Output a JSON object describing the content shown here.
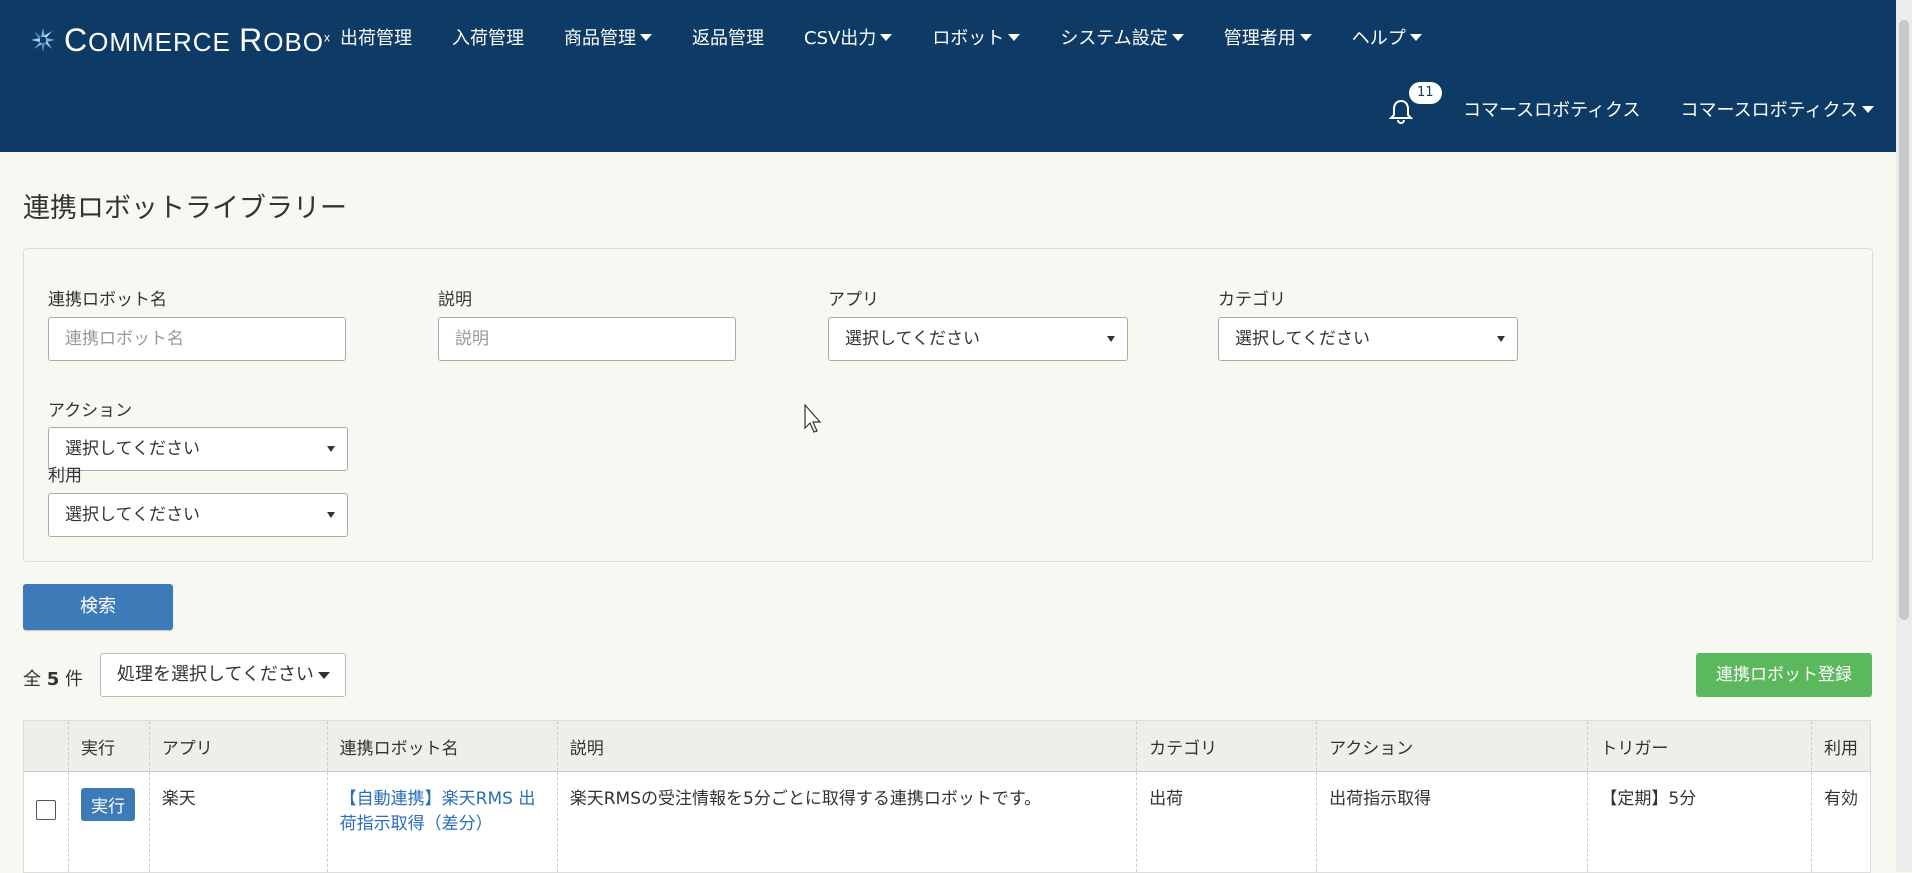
{
  "brand": {
    "logo_text_c": "C",
    "logo_text_rest": "OMMERCE ",
    "logo_text_r": "R",
    "logo_text_rest2": "OBO",
    "logo_sup": "x"
  },
  "nav": {
    "items": [
      {
        "label": "出荷管理",
        "dropdown": false
      },
      {
        "label": "入荷管理",
        "dropdown": false
      },
      {
        "label": "商品管理",
        "dropdown": true
      },
      {
        "label": "返品管理",
        "dropdown": false
      },
      {
        "label": "CSV出力",
        "dropdown": true
      },
      {
        "label": "ロボット",
        "dropdown": true
      },
      {
        "label": "システム設定",
        "dropdown": true
      },
      {
        "label": "管理者用",
        "dropdown": true
      },
      {
        "label": "ヘルプ",
        "dropdown": true
      }
    ]
  },
  "header_right": {
    "notification_count": "11",
    "company": "コマースロボティクス",
    "user": "コマースロボティクス"
  },
  "page": {
    "title": "連携ロボットライブラリー"
  },
  "filters": {
    "robot_name": {
      "label": "連携ロボット名",
      "placeholder": "連携ロボット名"
    },
    "description": {
      "label": "説明",
      "placeholder": "説明"
    },
    "app": {
      "label": "アプリ",
      "value": "選択してください"
    },
    "category": {
      "label": "カテゴリ",
      "value": "選択してください"
    },
    "action": {
      "label": "アクション",
      "value": "選択してください"
    },
    "usage": {
      "label": "利用",
      "value": "選択してください"
    }
  },
  "search_button": "検索",
  "results": {
    "count_prefix": "全",
    "count": "5",
    "count_suffix": "件",
    "bulk_action": "処理を選択してください"
  },
  "register_button": "連携ロボット登録",
  "table": {
    "headers": [
      "",
      "実行",
      "アプリ",
      "連携ロボット名",
      "説明",
      "カテゴリ",
      "アクション",
      "トリガー",
      "利用"
    ],
    "rows": [
      {
        "run": "実行",
        "app": "楽天",
        "name": "【自動連携】楽天RMS 出荷指示取得（差分）",
        "description": "楽天RMSの受注情報を5分ごとに取得する連携ロボットです。",
        "category": "出荷",
        "action": "出荷指示取得",
        "trigger": "【定期】5分",
        "usage": "有効"
      }
    ]
  },
  "colors": {
    "header_bg": "#0d3b66",
    "primary": "#3d7ab8",
    "success": "#5cb85c",
    "link": "#2a6ebb"
  }
}
